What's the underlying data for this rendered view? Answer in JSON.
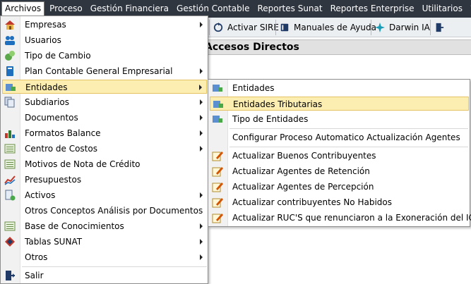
{
  "menubar": {
    "items": [
      {
        "label": "Archivos"
      },
      {
        "label": "Proceso"
      },
      {
        "label": "Gestión Financiera"
      },
      {
        "label": "Gestión Contable"
      },
      {
        "label": "Reportes Sunat"
      },
      {
        "label": "Reportes Enterprise"
      },
      {
        "label": "Utilitarios"
      },
      {
        "label": "?"
      }
    ]
  },
  "toolbar": {
    "items": [
      {
        "label": "Activar SIRE",
        "icon": "refresh-icon"
      },
      {
        "label": "Manuales de Ayuda",
        "icon": "book-icon"
      },
      {
        "label": "Darwin IA",
        "icon": "sparkle-icon"
      }
    ]
  },
  "section": {
    "title": "Accesos Directos"
  },
  "archivos_menu": {
    "items": [
      {
        "label": "Empresas",
        "icon": "home-icon"
      },
      {
        "label": "Usuarios",
        "icon": "users-icon"
      },
      {
        "label": "Tipo de Cambio",
        "icon": "exchange-icon"
      },
      {
        "label": "Plan Contable General Empresarial",
        "icon": "book-icon"
      },
      {
        "label": "Entidades",
        "icon": "entity-icon"
      },
      {
        "label": "Subdiarios",
        "icon": "documents-icon"
      },
      {
        "label": "Documentos",
        "icon": ""
      },
      {
        "label": "Formatos Balance",
        "icon": "chart-icon"
      },
      {
        "label": "Centro de Costos",
        "icon": "list-icon"
      },
      {
        "label": "Motivos de Nota de Crédito",
        "icon": "list-icon"
      },
      {
        "label": "Presupuestos",
        "icon": "line-chart-icon"
      },
      {
        "label": "Activos",
        "icon": "asset-icon"
      },
      {
        "label": "Otros Conceptos Análisis por Documentos",
        "icon": ""
      },
      {
        "label": "Base de Conocimientos",
        "icon": "list-icon"
      },
      {
        "label": "Tablas SUNAT",
        "icon": "sunat-icon"
      },
      {
        "label": "Otros",
        "icon": ""
      },
      {
        "label": "Salir",
        "icon": "exit-icon"
      }
    ]
  },
  "entidades_menu": {
    "items": [
      {
        "label": "Entidades",
        "icon": "entity-icon"
      },
      {
        "label": "Entidades Tributarias",
        "icon": "entity-icon"
      },
      {
        "label": "Tipo de Entidades",
        "icon": "entity-icon"
      },
      {
        "label": "Configurar Proceso Automatico Actualización Agentes",
        "icon": ""
      },
      {
        "label": "Actualizar Buenos Contribuyentes",
        "icon": "edit-icon"
      },
      {
        "label": "Actualizar Agentes de Retención",
        "icon": "edit-icon"
      },
      {
        "label": "Actualizar Agentes de Percepción",
        "icon": "edit-icon"
      },
      {
        "label": "Actualizar contribuyentes No Habidos",
        "icon": "edit-icon"
      },
      {
        "label": "Actualizar RUC'S que renunciaron a la Exoneración del IGV",
        "icon": "edit-icon"
      }
    ]
  },
  "colors": {
    "menubar": "#2f3640",
    "highlight": "#fcedb1",
    "highlight_border": "#e5c365"
  }
}
